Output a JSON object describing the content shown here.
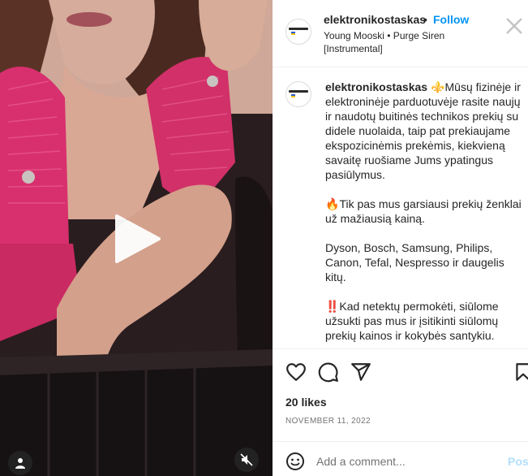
{
  "media": {
    "play_icon": "play-icon",
    "user_tag_icon": "person-icon",
    "mute_icon": "speaker-muted-icon"
  },
  "header": {
    "username": "elektronikostaskas",
    "separator": "•",
    "follow_label": "Follow",
    "audio": "Young Mooski • Purge Siren [Instrumental]",
    "close_icon": "close-icon"
  },
  "caption": {
    "username": "elektronikostaskas",
    "emoji_1": "⚜️",
    "paragraph_1": "Mūsų fizinėje ir elektroninėje parduotuvėje rasite naujų ir naudotų buitinės technikos prekių su didele nuolaida, taip pat prekiaujame ekspozicinėmis prekėmis, kiekvieną savaitę ruošiame Jums ypatingus pasiūlymus.",
    "emoji_2": "🔥",
    "paragraph_2": "Tik pas mus garsiausi prekių ženklai už mažiausią kainą.",
    "paragraph_3": "Dyson, Bosch, Samsung, Philips, Canon, Tefal, Nespresso ir daugelis kitų.",
    "paragraph_4": "‼️Kad netektų permokėti, siūlome užsukti pas mus ir įsitikinti siūlomų prekių kainos ir kokybės santykiu."
  },
  "actions": {
    "like_icon": "heart-icon",
    "comment_icon": "comment-bubble-icon",
    "share_icon": "paper-plane-icon",
    "save_icon": "bookmark-icon"
  },
  "likes": "20 likes",
  "date": "NOVEMBER 11, 2022",
  "comment": {
    "emoji_icon": "smiley-icon",
    "placeholder": "Add a comment...",
    "post_label": "Post"
  },
  "colors": {
    "link_blue": "#0095f6",
    "post_disabled": "#b2dffc",
    "jacket_pink": "#d8306e",
    "divider": "#efefef"
  }
}
